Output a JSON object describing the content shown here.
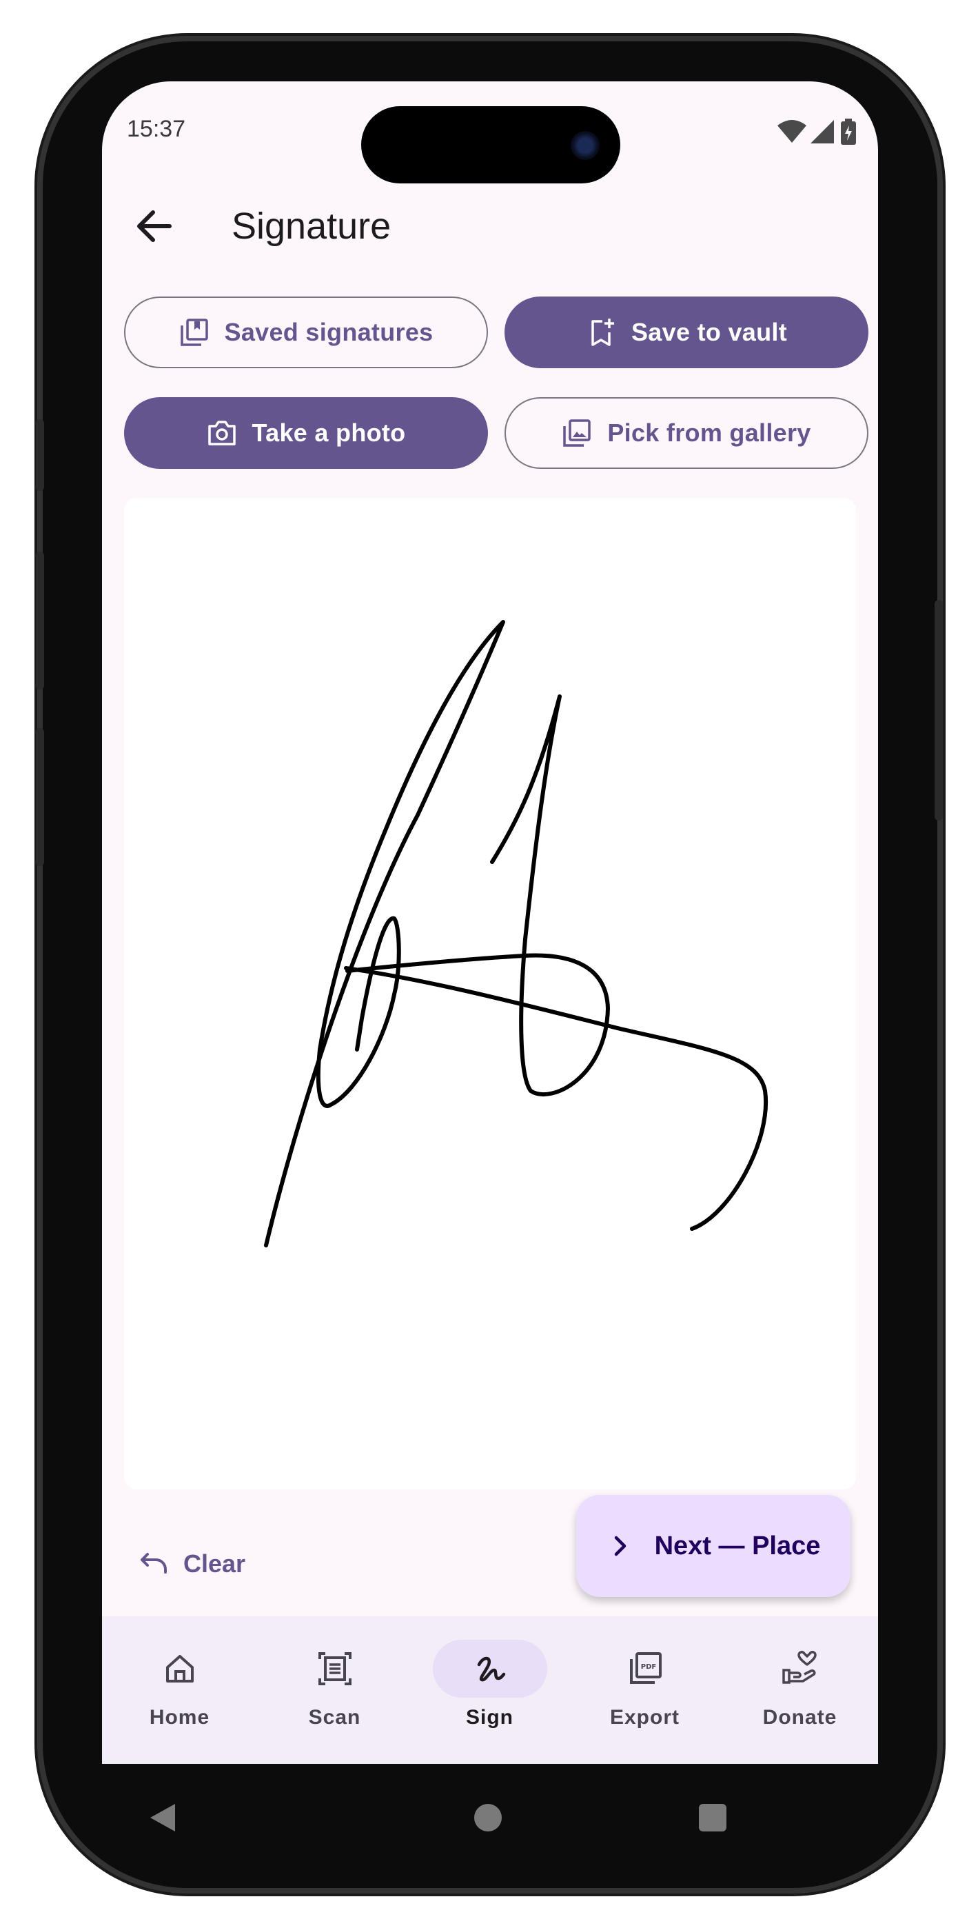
{
  "status_bar": {
    "time": "15:37",
    "icons": [
      "wifi-icon",
      "cell-signal-icon",
      "battery-icon"
    ]
  },
  "app_bar": {
    "back_icon": "arrow-left-icon",
    "title": "Signature"
  },
  "actions": {
    "saved_signatures": {
      "label": "Saved signatures",
      "icon": "library-icon"
    },
    "save_to_vault": {
      "label": "Save to vault",
      "icon": "bookmark-add-icon"
    },
    "take_photo": {
      "label": "Take a photo",
      "icon": "camera-icon"
    },
    "pick_gallery": {
      "label": "Pick from gallery",
      "icon": "gallery-icon"
    }
  },
  "canvas": {
    "has_signature": true
  },
  "bottom_actions": {
    "clear": {
      "label": "Clear",
      "icon": "undo-icon"
    },
    "next": {
      "label": "Next — Place",
      "icon": "chevron-right-icon"
    }
  },
  "nav": {
    "items": [
      {
        "label": "Home",
        "icon": "home-icon",
        "active": false
      },
      {
        "label": "Scan",
        "icon": "document-scanner-icon",
        "active": false
      },
      {
        "label": "Sign",
        "icon": "signature-icon",
        "active": true
      },
      {
        "label": "Export",
        "icon": "pdf-icon",
        "active": false
      },
      {
        "label": "Donate",
        "icon": "donate-hand-heart-icon",
        "active": false
      }
    ]
  },
  "colors": {
    "primary": "#65558f",
    "background": "#fdf7fc",
    "fab": "#eaddff",
    "nav_bar": "#f3edf7",
    "nav_indicator": "#e8def8"
  }
}
